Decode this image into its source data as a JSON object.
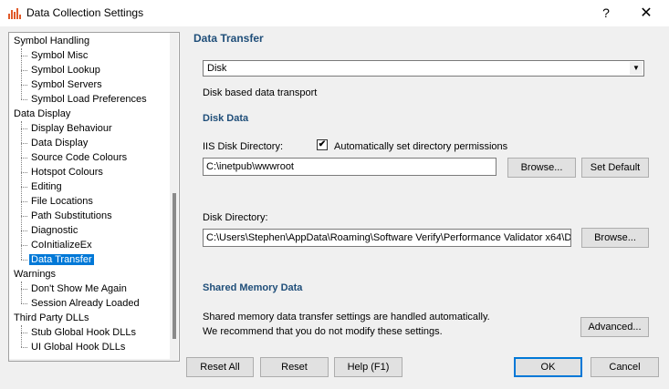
{
  "window": {
    "title": "Data Collection Settings",
    "help_glyph": "?",
    "close_glyph": "✕"
  },
  "tree": [
    {
      "label": "Symbol Handling",
      "level": 0
    },
    {
      "label": "Symbol Misc",
      "level": 1
    },
    {
      "label": "Symbol Lookup",
      "level": 1
    },
    {
      "label": "Symbol Servers",
      "level": 1
    },
    {
      "label": "Symbol Load Preferences",
      "level": 1
    },
    {
      "label": "Data Display",
      "level": 0
    },
    {
      "label": "Display Behaviour",
      "level": 1
    },
    {
      "label": "Data Display",
      "level": 1
    },
    {
      "label": "Source Code Colours",
      "level": 1
    },
    {
      "label": "Hotspot Colours",
      "level": 1
    },
    {
      "label": "Editing",
      "level": 1
    },
    {
      "label": "File Locations",
      "level": 1
    },
    {
      "label": "Path Substitutions",
      "level": 1
    },
    {
      "label": "Diagnostic",
      "level": 1
    },
    {
      "label": "CoInitializeEx",
      "level": 1
    },
    {
      "label": "Data Transfer",
      "level": 1,
      "selected": true
    },
    {
      "label": "Warnings",
      "level": 0
    },
    {
      "label": "Don't Show Me Again",
      "level": 1
    },
    {
      "label": "Session Already Loaded",
      "level": 1
    },
    {
      "label": "Third Party DLLs",
      "level": 0
    },
    {
      "label": "Stub Global Hook DLLs",
      "level": 1
    },
    {
      "label": "UI Global Hook DLLs",
      "level": 1
    }
  ],
  "panel": {
    "heading": "Data Transfer",
    "transport_select": "Disk",
    "transport_desc": "Disk based data transport",
    "disk_heading": "Disk Data",
    "iis_label": "IIS Disk Directory:",
    "auto_perm_label": "Automatically set directory permissions",
    "auto_perm_checked": true,
    "iis_value": "C:\\inetpub\\wwwroot",
    "browse_label": "Browse...",
    "set_default_label": "Set Default",
    "disk_dir_label": "Disk Directory:",
    "disk_dir_value": "C:\\Users\\Stephen\\AppData\\Roaming\\Software Verify\\Performance Validator x64\\D",
    "browse2_label": "Browse...",
    "shared_heading": "Shared Memory Data",
    "shared_line1": "Shared memory data transfer settings are handled automatically.",
    "shared_line2": "We recommend that you do not modify these settings.",
    "advanced_label": "Advanced..."
  },
  "footer": {
    "reset_all": "Reset All",
    "reset": "Reset",
    "help": "Help (F1)",
    "ok": "OK",
    "cancel": "Cancel"
  }
}
